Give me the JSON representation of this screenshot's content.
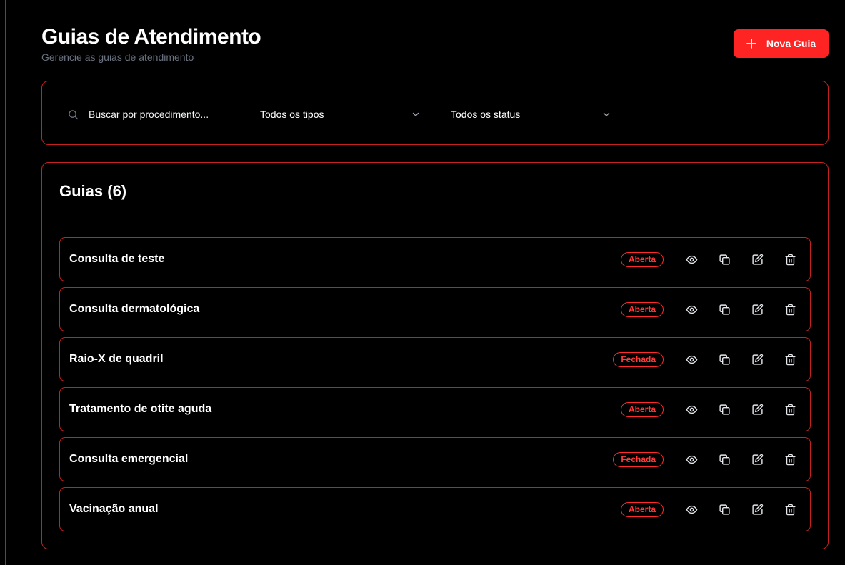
{
  "header": {
    "title": "Guias de Atendimento",
    "subtitle": "Gerencie as guias de atendimento",
    "new_button_label": "Nova Guia"
  },
  "filters": {
    "search_placeholder": "Buscar por procedimento...",
    "type_select_value": "Todos os tipos",
    "status_select_value": "Todos os status"
  },
  "list": {
    "title": "Guias (6)",
    "items": [
      {
        "title": "Consulta de teste",
        "status": "Aberta"
      },
      {
        "title": "Consulta dermatológica",
        "status": "Aberta"
      },
      {
        "title": "Raio-X de quadril",
        "status": "Fechada"
      },
      {
        "title": "Tratamento de otite aguda",
        "status": "Aberta"
      },
      {
        "title": "Consulta emergencial",
        "status": "Fechada"
      },
      {
        "title": "Vacinação anual",
        "status": "Aberta"
      }
    ]
  },
  "icons": {
    "plus": "plus-icon",
    "search": "search-icon",
    "chevron": "chevron-down-icon",
    "view": "eye-icon",
    "duplicate": "copy-icon",
    "edit": "edit-icon",
    "delete": "trash-icon"
  },
  "colors": {
    "accent": "#ff2424",
    "border": "#c5221f",
    "background": "#000000",
    "muted_text": "#6b7280"
  }
}
